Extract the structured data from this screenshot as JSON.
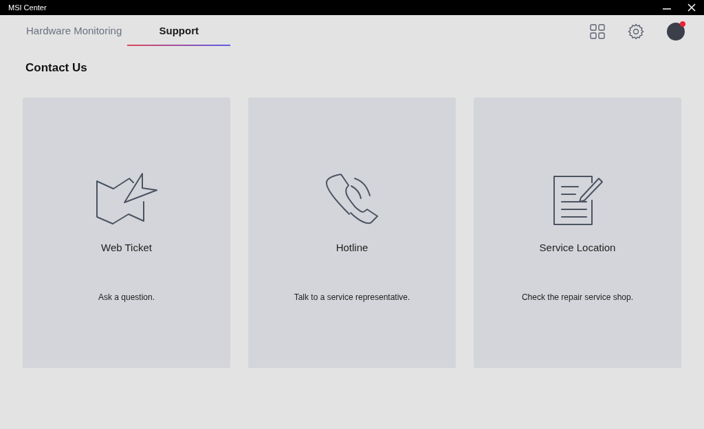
{
  "window": {
    "title": "MSI Center"
  },
  "tabs": [
    {
      "label": "Hardware Monitoring",
      "selected": false
    },
    {
      "label": "Support",
      "selected": true
    }
  ],
  "avatar": {
    "notification": true
  },
  "heading": "Contact Us",
  "cards": [
    {
      "kind": "map",
      "title": "Web Ticket",
      "description": "Ask a question."
    },
    {
      "kind": "phone",
      "title": "Hotline",
      "description": "Talk to a service representative."
    },
    {
      "kind": "note",
      "title": "Service Location",
      "description": "Check the repair service shop."
    }
  ]
}
